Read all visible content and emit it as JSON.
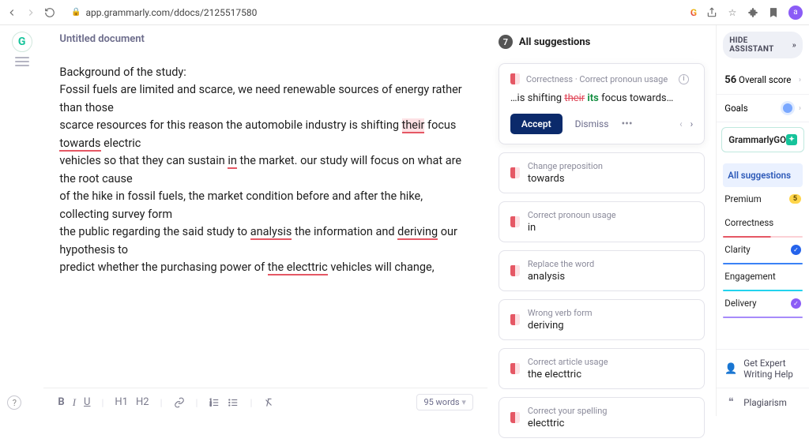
{
  "browser": {
    "url": "app.grammarly.com/ddocs/2125517580",
    "avatar_initial": "a"
  },
  "doc": {
    "title": "Untitled document",
    "p1": "Background of the study:",
    "p2a": "Fossil fuels are limited and scarce, we need renewable sources of energy rather than those",
    "p3a": "scarce resources for this reason the automobile industry is shifting ",
    "p3_their": "their",
    "p3b": " focus ",
    "p3_towards": "towards",
    "p3c": " electric",
    "p4a": "vehicles so that they can sustain ",
    "p4_in": "in",
    "p4b": " the market. our study will focus on what are the root cause",
    "p5": "of the hike in fossil fuels, the market condition before and after the hike, collecting survey form",
    "p6a": "the public regarding the said study to ",
    "p6_analysis": "analysis",
    "p6b": " the information and ",
    "p6_deriving": "deriving",
    "p6c": " our hypothesis to",
    "p7a": "predict whether the purchasing power of ",
    "p7_the_electtric": "the electtric",
    "p7b": " vehicles will change,"
  },
  "toolbar": {
    "word_count": "95 words"
  },
  "suggestions": {
    "count": "7",
    "header": "All suggestions",
    "active": {
      "category": "Correctness · Correct pronoun usage",
      "prefix": "…is shifting ",
      "strike": "their",
      "insert": " its",
      "suffix": " focus towards…",
      "accept": "Accept",
      "dismiss": "Dismiss"
    },
    "list": [
      {
        "label": "Change preposition",
        "value": "towards"
      },
      {
        "label": "Correct pronoun usage",
        "value": "in"
      },
      {
        "label": "Replace the word",
        "value": "analysis"
      },
      {
        "label": "Wrong verb form",
        "value": "deriving"
      },
      {
        "label": "Correct article usage",
        "value": "the electtric"
      },
      {
        "label": "Correct your spelling",
        "value": "electtric"
      }
    ]
  },
  "sidebar": {
    "hide": "HIDE ASSISTANT",
    "score_num": "56",
    "score_label": " Overall score",
    "goals": "Goals",
    "go": "GrammarlyGO",
    "filters": {
      "all": "All suggestions",
      "premium_label": "Premium",
      "premium_count": "5",
      "correctness": "Correctness",
      "clarity": "Clarity",
      "engagement": "Engagement",
      "delivery": "Delivery"
    },
    "help1": "Get Expert Writing Help",
    "help2": "Plagiarism"
  }
}
